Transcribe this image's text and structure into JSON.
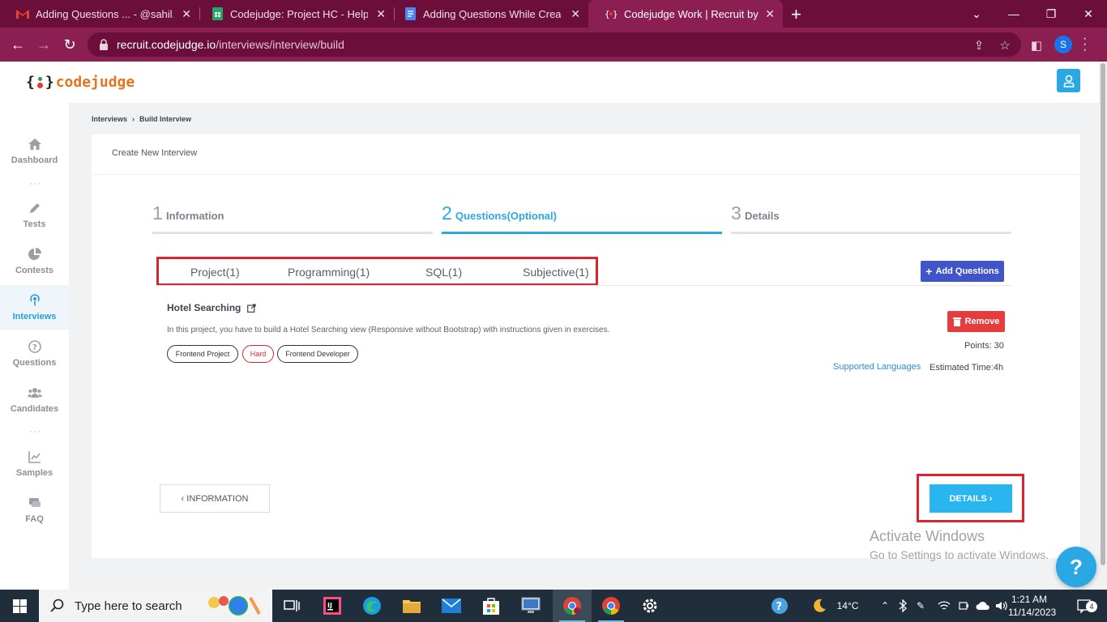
{
  "browser": {
    "tabs": [
      {
        "title": "Adding Questions ... - @sahil.sau",
        "icon": "gmail-icon"
      },
      {
        "title": "Codejudge: Project HC - Help ce",
        "icon": "sheets-icon"
      },
      {
        "title": "Adding Questions While Creatin",
        "icon": "docs-icon"
      },
      {
        "title": "Codejudge Work | Recruit by Re",
        "icon": "codejudge-icon"
      }
    ],
    "url_host": "recruit.codejudge.io",
    "url_path": "/interviews/interview/build",
    "profile_initial": "S",
    "colors": {
      "chrome": "#6b0f3a",
      "toolbar": "#8b1f52"
    }
  },
  "app": {
    "logo_brace_open": "{",
    "logo_brace_close": "}",
    "logo_name": "codejudge",
    "accent_color": "#29a8e3",
    "sidebar": [
      {
        "label": "Dashboard",
        "icon": "home-icon"
      },
      {
        "label": "Tests",
        "icon": "pencil-icon"
      },
      {
        "label": "Contests",
        "icon": "pie-chart-icon"
      },
      {
        "label": "Interviews",
        "icon": "podcast-icon",
        "active": true
      },
      {
        "label": "Questions",
        "icon": "question-circle-icon"
      },
      {
        "label": "Candidates",
        "icon": "users-icon"
      },
      {
        "label": "Samples",
        "icon": "line-chart-icon"
      },
      {
        "label": "FAQ",
        "icon": "comments-icon"
      }
    ],
    "sidebar_dots": "···"
  },
  "breadcrumb": {
    "items": [
      "Interviews",
      "Build Interview"
    ],
    "separator": "›"
  },
  "card": {
    "title": "Create New Interview",
    "steps": [
      {
        "num": "1",
        "label": "Information"
      },
      {
        "num": "2",
        "label": "Questions(Optional)",
        "active": true
      },
      {
        "num": "3",
        "label": "Details"
      }
    ],
    "question_tabs": [
      "Project(1)",
      "Programming(1)",
      "SQL(1)",
      "Subjective(1)"
    ],
    "add_questions_label": "Add Questions",
    "question": {
      "title": "Hotel Searching",
      "description": "In this project, you have to build a Hotel Searching view (Responsive without Bootstrap) with instructions given in exercises.",
      "tags": [
        "Frontend Project",
        "Hard",
        "Frontend Developer"
      ],
      "remove_label": "Remove",
      "points": "Points: 30",
      "supported_languages": "Supported Languages",
      "estimated_time": "Estimated Time:4h"
    },
    "back_button": "‹ INFORMATION",
    "next_button": "DETAILS ›"
  },
  "watermark": {
    "line1": "Activate Windows",
    "line2": "Go to Settings to activate Windows."
  },
  "help_label": "?",
  "taskbar": {
    "search_placeholder": "Type here to search",
    "weather": "14°C",
    "time": "1:21 AM",
    "date": "11/14/2023",
    "notifications": "4"
  }
}
